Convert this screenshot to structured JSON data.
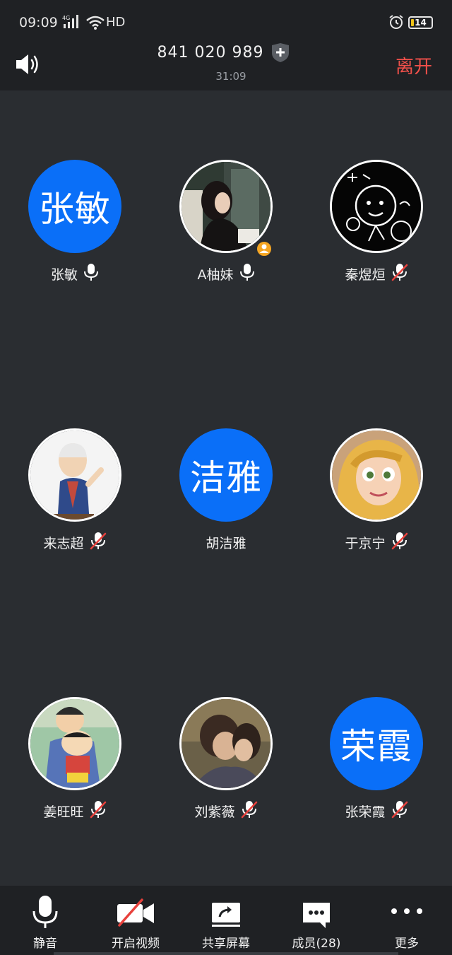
{
  "status_bar": {
    "time": "09:09",
    "network": "HD",
    "battery": "14",
    "battery_level": 0.14
  },
  "header": {
    "meeting_id": "841 020 989",
    "duration": "31:09",
    "leave_label": "离开",
    "icons": {
      "speaker": "speaker-icon",
      "security": "shield-plus-icon"
    }
  },
  "participants": [
    {
      "name": "张敏",
      "avatar_text": "张敏",
      "mic": "on"
    },
    {
      "name": "A柚妹",
      "avatar": "photo",
      "mic": "on",
      "host": true
    },
    {
      "name": "秦煜烜",
      "avatar": "photo",
      "mic": "muted"
    },
    {
      "name": "来志超",
      "avatar": "photo",
      "mic": "muted"
    },
    {
      "name": "胡洁雅",
      "avatar_text": "洁雅",
      "mic": "none"
    },
    {
      "name": "于京宁",
      "avatar": "photo",
      "mic": "muted"
    },
    {
      "name": "姜旺旺",
      "avatar": "photo",
      "mic": "muted"
    },
    {
      "name": "刘紫薇",
      "avatar": "photo",
      "mic": "muted"
    },
    {
      "name": "张荣霞",
      "avatar_text": "荣霞",
      "mic": "muted"
    }
  ],
  "toolbar": {
    "mute": "静音",
    "video": "开启视频",
    "share": "共享屏幕",
    "members": "成员(28)",
    "more": "更多"
  },
  "colors": {
    "accent_blue": "#0a6ff8",
    "leave_red": "#f0504a",
    "muted_red": "#e8413c",
    "background": "#2a2d31"
  }
}
